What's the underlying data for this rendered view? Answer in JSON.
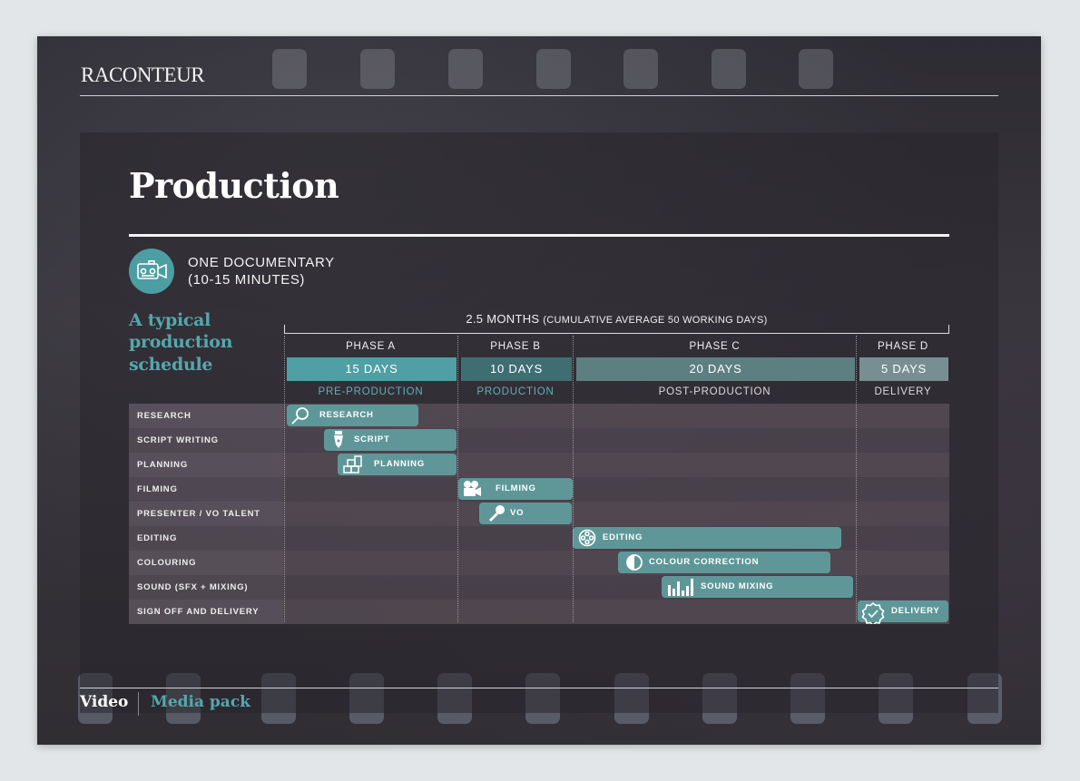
{
  "brand": {
    "logo": "RACONTEUR"
  },
  "title": "Production",
  "doc": {
    "line1": "ONE DOCUMENTARY",
    "line2": "(10-15 MINUTES)"
  },
  "subtitle": {
    "line1": "A typical",
    "line2": "production",
    "line3": "schedule"
  },
  "span": {
    "main": "2.5 MONTHS",
    "detail": "(CUMULATIVE AVERAGE 50 WORKING DAYS)"
  },
  "phases": [
    {
      "phase": "PHASE A",
      "days": "15 DAYS",
      "stage": "PRE-PRODUCTION",
      "color": "#4f9fa4",
      "stage_color": "#5fb1b4"
    },
    {
      "phase": "PHASE B",
      "days": "10 DAYS",
      "stage": "PRODUCTION",
      "color": "#3f6e72",
      "stage_color": "#5fb1b4"
    },
    {
      "phase": "PHASE C",
      "days": "20 DAYS",
      "stage": "POST-PRODUCTION",
      "color": "#5e7f82",
      "stage_color": "#d8dcdd"
    },
    {
      "phase": "PHASE D",
      "days": "5 DAYS",
      "stage": "DELIVERY",
      "color": "#788f92",
      "stage_color": "#d8dcdd"
    }
  ],
  "rows": [
    {
      "label": "RESEARCH",
      "bar": "RESEARCH",
      "icon": "magnifier-icon"
    },
    {
      "label": "SCRIPT WRITING",
      "bar": "SCRIPT",
      "icon": "pen-nib-icon"
    },
    {
      "label": "PLANNING",
      "bar": "PLANNING",
      "icon": "blocks-icon"
    },
    {
      "label": "FILMING",
      "bar": "FILMING",
      "icon": "camera-icon"
    },
    {
      "label": "PRESENTER / VO TALENT",
      "bar": "VO",
      "icon": "microphone-icon"
    },
    {
      "label": "EDITING",
      "bar": "EDITING",
      "icon": "film-reel-icon"
    },
    {
      "label": "COLOURING",
      "bar": "COLOUR CORRECTION",
      "icon": "contrast-icon"
    },
    {
      "label": "SOUND (SFX + MIXING)",
      "bar": "SOUND MIXING",
      "icon": "equalizer-icon"
    },
    {
      "label": "SIGN OFF AND DELIVERY",
      "bar": "DELIVERY",
      "icon": "check-badge-icon"
    }
  ],
  "footer": {
    "section": "Video",
    "pack": "Media pack"
  }
}
